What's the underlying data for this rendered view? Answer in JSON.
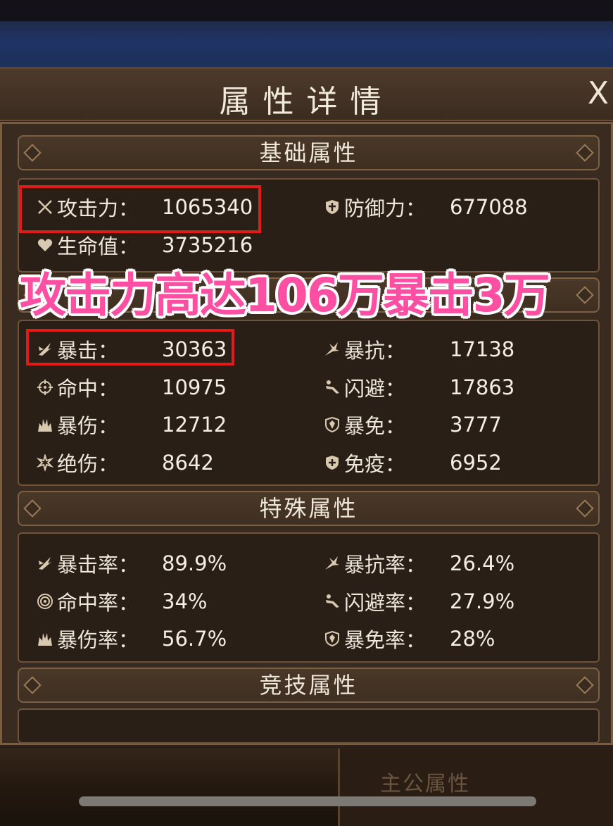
{
  "panel": {
    "title": "属性详情",
    "close_label": "X"
  },
  "sections": {
    "basic": {
      "title": "基础属性"
    },
    "combat": {
      "title": ""
    },
    "special": {
      "title": "特殊属性"
    },
    "arena": {
      "title": "竞技属性"
    }
  },
  "basic_stats": [
    {
      "icon": "crossed-swords-icon",
      "label": "攻击力：",
      "value": "1065340"
    },
    {
      "icon": "shield-cross-icon",
      "label": "防御力：",
      "value": "677088"
    },
    {
      "icon": "heart-icon",
      "label": "生命值：",
      "value": "3735216"
    }
  ],
  "combat_stats": [
    {
      "icon": "crit-claw-icon",
      "label": "暴击：",
      "value": "30363"
    },
    {
      "icon": "crit-resist-icon",
      "label": "暴抗：",
      "value": "17138"
    },
    {
      "icon": "crosshair-icon",
      "label": "命中：",
      "value": "10975"
    },
    {
      "icon": "dodge-icon",
      "label": "闪避：",
      "value": "17863"
    },
    {
      "icon": "flame-burst-icon",
      "label": "暴伤：",
      "value": "12712"
    },
    {
      "icon": "shield-emblem-icon",
      "label": "暴免：",
      "value": "3777"
    },
    {
      "icon": "star-icon",
      "label": "绝伤：",
      "value": "8642"
    },
    {
      "icon": "shield-plus-icon",
      "label": "免疫：",
      "value": "6952"
    }
  ],
  "special_stats": [
    {
      "icon": "crit-claw-icon",
      "label": "暴击率：",
      "value": "89.9%"
    },
    {
      "icon": "crit-resist-icon",
      "label": "暴抗率：",
      "value": "26.4%"
    },
    {
      "icon": "target-icon",
      "label": "命中率：",
      "value": "34%"
    },
    {
      "icon": "dodge-icon",
      "label": "闪避率：",
      "value": "27.9%"
    },
    {
      "icon": "flame-burst-icon",
      "label": "暴伤率：",
      "value": "56.7%"
    },
    {
      "icon": "shield-emblem-icon",
      "label": "暴免率：",
      "value": "28%"
    }
  ],
  "overlay_caption": "攻击力高达106万暴击3万",
  "background": {
    "faded_text": "主公属性"
  },
  "colors": {
    "highlight": "#e21a1a",
    "caption": "#ff4fa3",
    "panel": "#2b211a"
  }
}
